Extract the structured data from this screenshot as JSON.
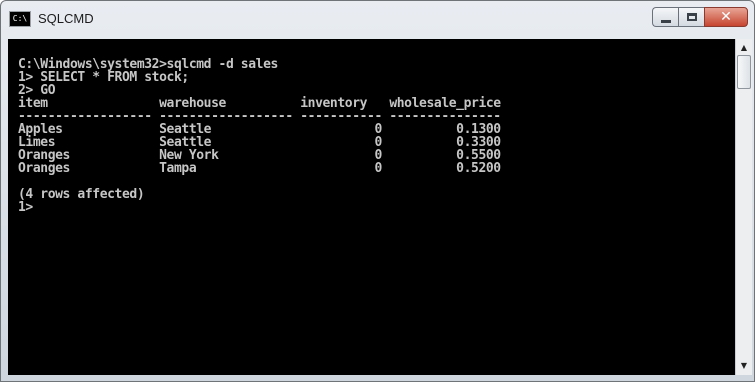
{
  "window": {
    "title": "SQLCMD",
    "icon_text": "C:\\"
  },
  "console": {
    "lines": [
      "C:\\Windows\\system32>sqlcmd -d sales",
      "1> SELECT * FROM stock;",
      "2> GO",
      "item               warehouse          inventory   wholesale_price",
      "------------------ ------------------ ----------- ---------------",
      "Apples             Seattle                      0          0.1300",
      "Limes              Seattle                      0          0.3300",
      "Oranges            New York                     0          0.5500",
      "Oranges            Tampa                        0          0.5200",
      "",
      "(4 rows affected)",
      "1>"
    ]
  },
  "controls": {
    "minimize": "minimize-icon",
    "maximize": "maximize-icon",
    "close": "close-icon",
    "close_glyph": "✕"
  },
  "scrollbar": {
    "up_arrow": "▲",
    "down_arrow": "▼"
  },
  "colors": {
    "console_bg": "#000000",
    "console_text": "#c6c6c6",
    "close_button": "#c6452f"
  }
}
